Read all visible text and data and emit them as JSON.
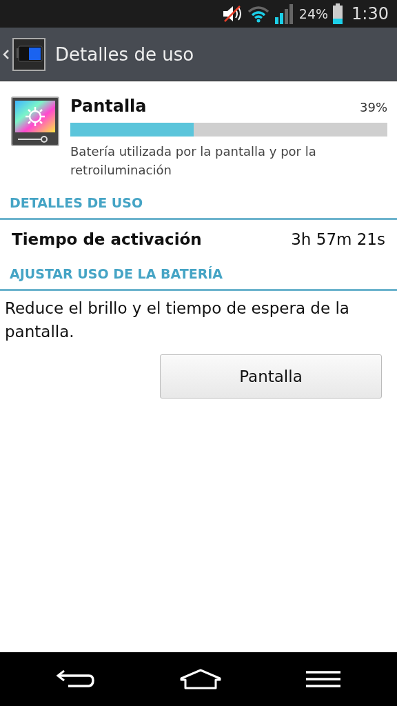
{
  "status_bar": {
    "battery": "24%",
    "time": "1:30"
  },
  "action_bar": {
    "title": "Detalles de uso"
  },
  "app": {
    "name": "Pantalla",
    "percent": "39%",
    "level": 0.39,
    "description": "Batería utilizada por la pantalla y por la retroiluminación"
  },
  "sections": [
    {
      "header": "DETALLES DE USO",
      "kind": "stat",
      "label": "Tiempo de activación",
      "value": "3h 57m 21s"
    },
    {
      "header": "AJUSTAR USO DE LA BATERÍA",
      "kind": "action",
      "text": "Reduce el brillo y el tiempo de espera de la pantalla.",
      "button": "Pantalla"
    }
  ]
}
